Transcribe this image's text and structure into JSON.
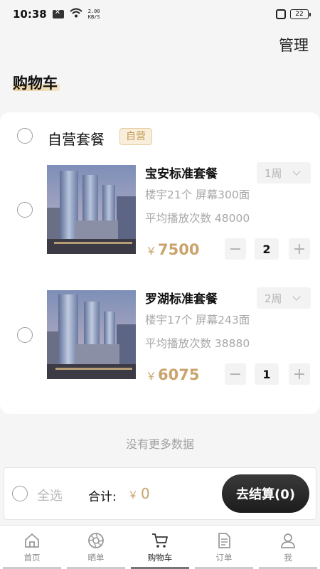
{
  "status_bar": {
    "time": "10:38",
    "speed_value": "2.00",
    "speed_unit": "KB/S",
    "battery": "22"
  },
  "header": {
    "manage_label": "管理",
    "title": "购物车"
  },
  "group": {
    "name": "自营套餐",
    "tag": "自营"
  },
  "items": [
    {
      "name": "宝安标准套餐",
      "period": "1周",
      "info_line1": "楼宇21个 屏幕300面",
      "info_line2": "平均播放次数 48000",
      "currency": "￥",
      "price": "7500",
      "quantity": "2"
    },
    {
      "name": "罗湖标准套餐",
      "period": "2周",
      "info_line1": "楼宇17个 屏幕243面",
      "info_line2": "平均播放次数 38880",
      "currency": "￥",
      "price": "6075",
      "quantity": "1"
    }
  ],
  "stepper": {
    "minus": "−",
    "plus": "+"
  },
  "no_more_text": "没有更多数据",
  "checkout": {
    "select_all_label": "全选",
    "total_label": "合计:",
    "currency": "￥",
    "total_value": "0",
    "button_label": "去结算(0)"
  },
  "tabbar": {
    "tabs": [
      {
        "label": "首页",
        "icon": "home-icon"
      },
      {
        "label": "晒单",
        "icon": "aperture-icon"
      },
      {
        "label": "购物车",
        "icon": "cart-icon",
        "active": true
      },
      {
        "label": "订单",
        "icon": "document-icon"
      },
      {
        "label": "我",
        "icon": "person-icon"
      }
    ]
  },
  "colors": {
    "accent_gold": "#c9a36c",
    "checkout_button": "#222222",
    "background": "#f5f5f5"
  }
}
